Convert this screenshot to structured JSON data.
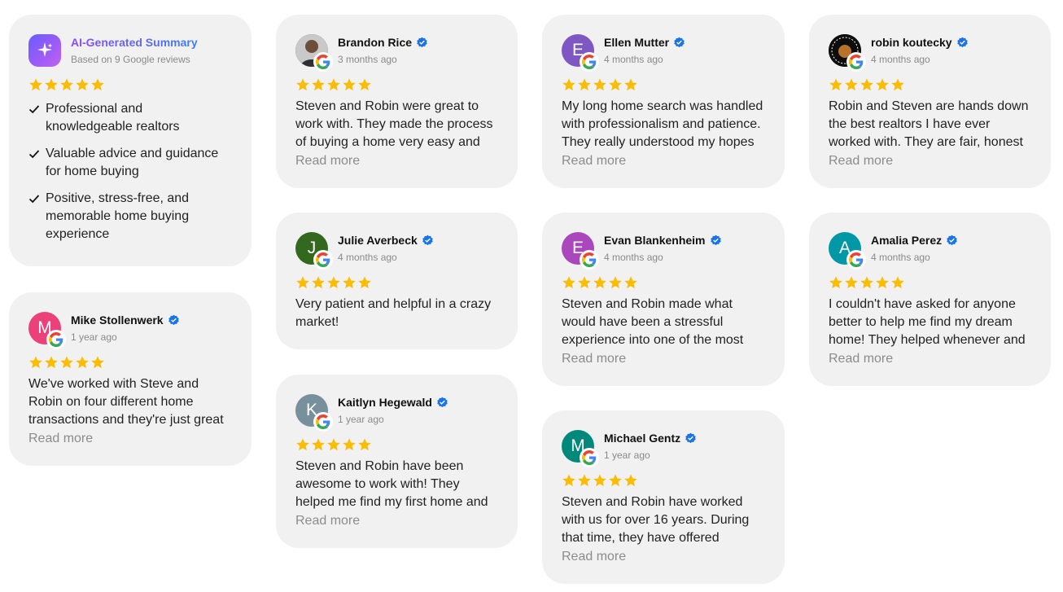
{
  "colors": {
    "star": "#fbbc04",
    "verified": "#1a73e8",
    "card_bg": "#f1f1f1",
    "read_more": "#8c8c8c"
  },
  "summary": {
    "title": "AI-Generated Summary",
    "subtitle": "Based on 9 Google reviews",
    "rating": 5,
    "points": [
      "Professional and knowledgeable realtors",
      "Valuable advice and guidance for home buying",
      "Positive, stress-free, and memorable home buying experience"
    ]
  },
  "reviews": [
    {
      "name": "Brandon Rice",
      "time": "3 months ago",
      "initial": "",
      "avatar_color": "#3a3a3a",
      "avatar_kind": "photo-person",
      "rating": 5,
      "text": "Steven and Robin were great to work with. They made the process of buying a home very easy and",
      "read_more": "Read more"
    },
    {
      "name": "Ellen Mutter",
      "time": "4 months ago",
      "initial": "E",
      "avatar_color": "#7e57c2",
      "rating": 5,
      "text": "My long home search was handled with professionalism and patience. They really understood my hopes",
      "read_more": "Read more"
    },
    {
      "name": "robin koutecky",
      "time": "4 months ago",
      "initial": "",
      "avatar_color": "#111111",
      "avatar_kind": "photo-logo",
      "rating": 5,
      "text": "Robin and Steven are hands down the best realtors I have ever worked with. They are fair, honest",
      "read_more": "Read more"
    },
    {
      "name": "Julie Averbeck",
      "time": "4 months ago",
      "initial": "J",
      "avatar_color": "#33691e",
      "rating": 5,
      "text": "Very patient and helpful in a crazy market!",
      "read_more": ""
    },
    {
      "name": "Evan Blankenheim",
      "time": "4 months ago",
      "initial": "E",
      "avatar_color": "#ab47bc",
      "rating": 5,
      "text": "Steven and Robin made what would have been a stressful experience into one of the most",
      "read_more": "Read more"
    },
    {
      "name": "Amalia Perez",
      "time": "4 months ago",
      "initial": "A",
      "avatar_color": "#0097a7",
      "rating": 5,
      "text": "I couldn't have asked for anyone better to help me find my dream home! They helped whenever and",
      "read_more": "Read more"
    },
    {
      "name": "Mike Stollenwerk",
      "time": "1 year ago",
      "initial": "M",
      "avatar_color": "#ec407a",
      "rating": 5,
      "text": "We've worked with Steve and Robin on four different home transactions and they're just great",
      "read_more": "Read more"
    },
    {
      "name": "Kaitlyn Hegewald",
      "time": "1 year ago",
      "initial": "K",
      "avatar_color": "#78909c",
      "rating": 5,
      "text": "Steven and Robin have been awesome to work with! They helped me find my first home and",
      "read_more": "Read more"
    },
    {
      "name": "Michael Gentz",
      "time": "1 year ago",
      "initial": "M",
      "avatar_color": "#00897b",
      "rating": 5,
      "text": "Steven and Robin have worked with us for over 16 years. During that time, they have offered",
      "read_more": "Read more"
    }
  ]
}
